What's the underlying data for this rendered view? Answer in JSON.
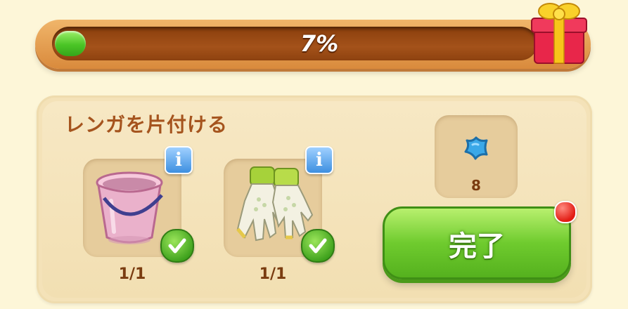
{
  "progress": {
    "percent_label": "7%",
    "fill_fraction": 0.07
  },
  "task": {
    "title": "レンガを片付ける",
    "items": [
      {
        "icon": "pink-bucket-icon",
        "count": "1/1",
        "completed": true
      },
      {
        "icon": "gardening-gloves-icon",
        "count": "1/1",
        "completed": true
      }
    ]
  },
  "reward": {
    "icon": "blue-star-icon",
    "count": "8"
  },
  "actions": {
    "done_label": "完了"
  },
  "colors": {
    "accent_green": "#6fcb2e",
    "title_brown": "#a5541e",
    "track_brown": "#8a3e0c"
  }
}
